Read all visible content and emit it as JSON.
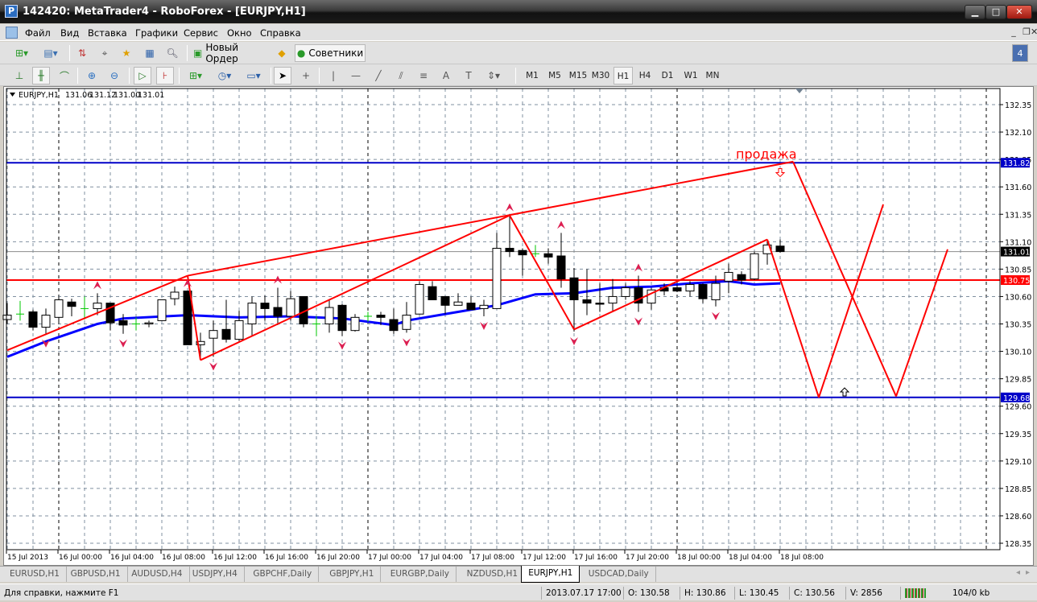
{
  "window": {
    "title": "142420: MetaTrader4 - RoboForex - [EURJPY,H1]",
    "buttons": [
      "minimize",
      "maximize",
      "close"
    ]
  },
  "menu": [
    "Файл",
    "Вид",
    "Вставка",
    "Графики",
    "Сервис",
    "Окно",
    "Справка"
  ],
  "toolbar1": {
    "new_order": "Новый Ордер",
    "experts": "Советники",
    "notifications_count": "4"
  },
  "timeframes": [
    "M1",
    "M5",
    "M15",
    "M30",
    "H1",
    "H4",
    "D1",
    "W1",
    "MN"
  ],
  "active_timeframe": "H1",
  "chart_header": {
    "symbol": "EURJPY,H1",
    "open": "131.06",
    "high": "131.12",
    "low": "131.00",
    "close": "131.01"
  },
  "annotation_text": "продажа",
  "colors": {
    "bull": "#ffffff",
    "bear": "#000000",
    "ma": "#0000ff",
    "zigzag": "#ff0000",
    "level_blue": "#0000c8",
    "level_red": "#ff0000",
    "fractal": "#dc1e50"
  },
  "chart_data": {
    "type": "candlestick",
    "ylim": [
      128.35,
      132.35
    ],
    "yticks": [
      "132.35",
      "132.10",
      "131.85",
      "131.60",
      "131.35",
      "131.10",
      "130.85",
      "130.60",
      "130.35",
      "130.10",
      "129.85",
      "129.60",
      "129.35",
      "129.10",
      "128.85",
      "128.60",
      "128.35"
    ],
    "xticks": [
      "15 Jul 2013",
      "16 Jul 00:00",
      "16 Jul 04:00",
      "16 Jul 08:00",
      "16 Jul 12:00",
      "16 Jul 16:00",
      "16 Jul 20:00",
      "17 Jul 00:00",
      "17 Jul 04:00",
      "17 Jul 08:00",
      "17 Jul 12:00",
      "17 Jul 16:00",
      "17 Jul 20:00",
      "18 Jul 00:00",
      "18 Jul 04:00",
      "18 Jul 08:00"
    ],
    "price_labels": [
      {
        "value": "131.82",
        "price": 131.82,
        "color": "#0000c8"
      },
      {
        "value": "131.01",
        "price": 131.01,
        "color": "#000000"
      },
      {
        "value": "130.75",
        "price": 130.75,
        "color": "#ff0000"
      },
      {
        "value": "129.68",
        "price": 129.68,
        "color": "#0000c8"
      }
    ],
    "horizontal_levels": [
      {
        "price": 131.82,
        "color": "#0000c8"
      },
      {
        "price": 130.75,
        "color": "#ff0000"
      },
      {
        "price": 129.68,
        "color": "#0000c8"
      },
      {
        "price": 131.01,
        "color": "#8c8c8c"
      }
    ],
    "candles_ohlc": [
      [
        130.39,
        130.54,
        130.35,
        130.43
      ],
      [
        130.44,
        130.56,
        130.38,
        130.44
      ],
      [
        130.46,
        130.48,
        130.29,
        130.32
      ],
      [
        130.32,
        130.49,
        130.26,
        130.43
      ],
      [
        130.41,
        130.6,
        130.35,
        130.57
      ],
      [
        130.55,
        130.58,
        130.42,
        130.51
      ],
      [
        130.49,
        130.6,
        130.39,
        130.49
      ],
      [
        130.49,
        130.63,
        130.43,
        130.54
      ],
      [
        130.54,
        130.54,
        130.29,
        130.36
      ],
      [
        130.38,
        130.44,
        130.26,
        130.34
      ],
      [
        130.35,
        130.41,
        130.29,
        130.35
      ],
      [
        130.35,
        130.38,
        130.32,
        130.36
      ],
      [
        130.38,
        130.57,
        130.38,
        130.57
      ],
      [
        130.58,
        130.69,
        130.52,
        130.64
      ],
      [
        130.65,
        130.65,
        130.16,
        130.16
      ],
      [
        130.16,
        130.27,
        130.04,
        130.19
      ],
      [
        130.22,
        130.38,
        130.05,
        130.29
      ],
      [
        130.3,
        130.57,
        130.18,
        130.21
      ],
      [
        130.21,
        130.47,
        130.18,
        130.38
      ],
      [
        130.35,
        130.6,
        130.24,
        130.54
      ],
      [
        130.54,
        130.61,
        130.38,
        130.49
      ],
      [
        130.5,
        130.68,
        130.34,
        130.42
      ],
      [
        130.42,
        130.65,
        130.38,
        130.58
      ],
      [
        130.6,
        130.6,
        130.32,
        130.35
      ],
      [
        130.35,
        130.42,
        130.24,
        130.35
      ],
      [
        130.35,
        130.57,
        130.27,
        130.5
      ],
      [
        130.52,
        130.53,
        130.24,
        130.29
      ],
      [
        130.29,
        130.44,
        130.28,
        130.41
      ],
      [
        130.42,
        130.46,
        130.37,
        130.42
      ],
      [
        130.43,
        130.46,
        130.34,
        130.41
      ],
      [
        130.39,
        130.49,
        130.26,
        130.29
      ],
      [
        130.3,
        130.55,
        130.27,
        130.43
      ],
      [
        130.44,
        130.74,
        130.44,
        130.71
      ],
      [
        130.69,
        130.74,
        130.57,
        130.57
      ],
      [
        130.6,
        130.6,
        130.44,
        130.52
      ],
      [
        130.52,
        130.63,
        130.52,
        130.55
      ],
      [
        130.54,
        130.6,
        130.48,
        130.48
      ],
      [
        130.49,
        130.57,
        130.42,
        130.52
      ],
      [
        130.49,
        131.18,
        130.49,
        131.04
      ],
      [
        131.04,
        131.34,
        130.96,
        131.01
      ],
      [
        131.02,
        131.04,
        130.79,
        130.98
      ],
      [
        130.99,
        131.07,
        130.96,
        130.99
      ],
      [
        130.99,
        131.04,
        130.9,
        130.96
      ],
      [
        130.97,
        131.18,
        130.68,
        130.76
      ],
      [
        130.77,
        130.86,
        130.28,
        130.57
      ],
      [
        130.57,
        130.85,
        130.43,
        130.54
      ],
      [
        130.54,
        130.72,
        130.46,
        130.53
      ],
      [
        130.54,
        130.76,
        130.46,
        130.6
      ],
      [
        130.6,
        130.72,
        130.57,
        130.68
      ],
      [
        130.68,
        130.79,
        130.46,
        130.54
      ],
      [
        130.54,
        130.68,
        130.48,
        130.66
      ],
      [
        130.68,
        130.72,
        130.61,
        130.65
      ],
      [
        130.68,
        130.71,
        130.64,
        130.65
      ],
      [
        130.65,
        130.74,
        130.6,
        130.71
      ],
      [
        130.71,
        130.72,
        130.54,
        130.58
      ],
      [
        130.57,
        130.79,
        130.51,
        130.72
      ],
      [
        130.74,
        130.9,
        130.63,
        130.82
      ],
      [
        130.8,
        130.83,
        130.71,
        130.75
      ],
      [
        130.76,
        131.01,
        130.75,
        130.99
      ],
      [
        130.99,
        131.12,
        130.89,
        131.07
      ],
      [
        131.06,
        131.12,
        131.0,
        131.01
      ]
    ],
    "moving_average": [
      [
        0,
        130.05
      ],
      [
        3,
        130.19
      ],
      [
        7,
        130.35
      ],
      [
        9,
        130.4
      ],
      [
        14,
        130.43
      ],
      [
        18,
        130.41
      ],
      [
        22,
        130.42
      ],
      [
        26,
        130.4
      ],
      [
        30,
        130.34
      ],
      [
        31,
        130.38
      ],
      [
        35,
        130.46
      ],
      [
        38,
        130.52
      ],
      [
        41,
        130.62
      ],
      [
        44,
        130.63
      ],
      [
        47,
        130.68
      ],
      [
        50,
        130.69
      ],
      [
        53,
        130.72
      ],
      [
        56,
        130.74
      ],
      [
        58,
        130.71
      ],
      [
        60,
        130.72
      ]
    ],
    "trend_lines": [
      [
        [
          0,
          130.11
        ],
        [
          14,
          130.79
        ]
      ],
      [
        [
          14,
          130.79
        ],
        [
          61,
          131.83
        ]
      ],
      [
        [
          14,
          130.79
        ],
        [
          15,
          130.02
        ]
      ],
      [
        [
          15,
          130.02
        ],
        [
          39,
          131.34
        ]
      ],
      [
        [
          39,
          131.34
        ],
        [
          44,
          130.3
        ]
      ],
      [
        [
          44,
          130.3
        ],
        [
          59,
          131.12
        ]
      ],
      [
        [
          59,
          131.12
        ],
        [
          63,
          129.68
        ]
      ],
      [
        [
          63,
          129.68
        ],
        [
          68,
          131.44
        ]
      ],
      [
        [
          61,
          131.83
        ],
        [
          69,
          129.69
        ]
      ],
      [
        [
          69,
          129.69
        ],
        [
          73,
          131.03
        ]
      ]
    ],
    "fractals_up": [
      7,
      14,
      21,
      39,
      43,
      49
    ],
    "fractals_down": [
      3,
      9,
      16,
      26,
      31,
      37,
      44,
      49,
      55
    ],
    "signal_arrows": [
      {
        "dir": "down",
        "index": 60,
        "price": 131.73
      },
      {
        "dir": "up",
        "index": 65,
        "price": 129.73
      }
    ]
  },
  "tabs": [
    "EURUSD,H1",
    "GBPUSD,H1",
    "AUDUSD,H4",
    "USDJPY,H4",
    "GBPCHF,Daily",
    "GBPJPY,H1",
    "EURGBP,Daily",
    "NZDUSD,H1",
    "EURJPY,H1",
    "USDCAD,Daily"
  ],
  "active_tab": "EURJPY,H1",
  "status": {
    "help": "Для справки, нажмите F1",
    "datetime": "2013.07.17 17:00",
    "open": "O: 130.58",
    "high": "H: 130.86",
    "low": "L: 130.45",
    "close": "C: 130.56",
    "volume": "V: 2856",
    "traffic": "104/0 kb"
  }
}
